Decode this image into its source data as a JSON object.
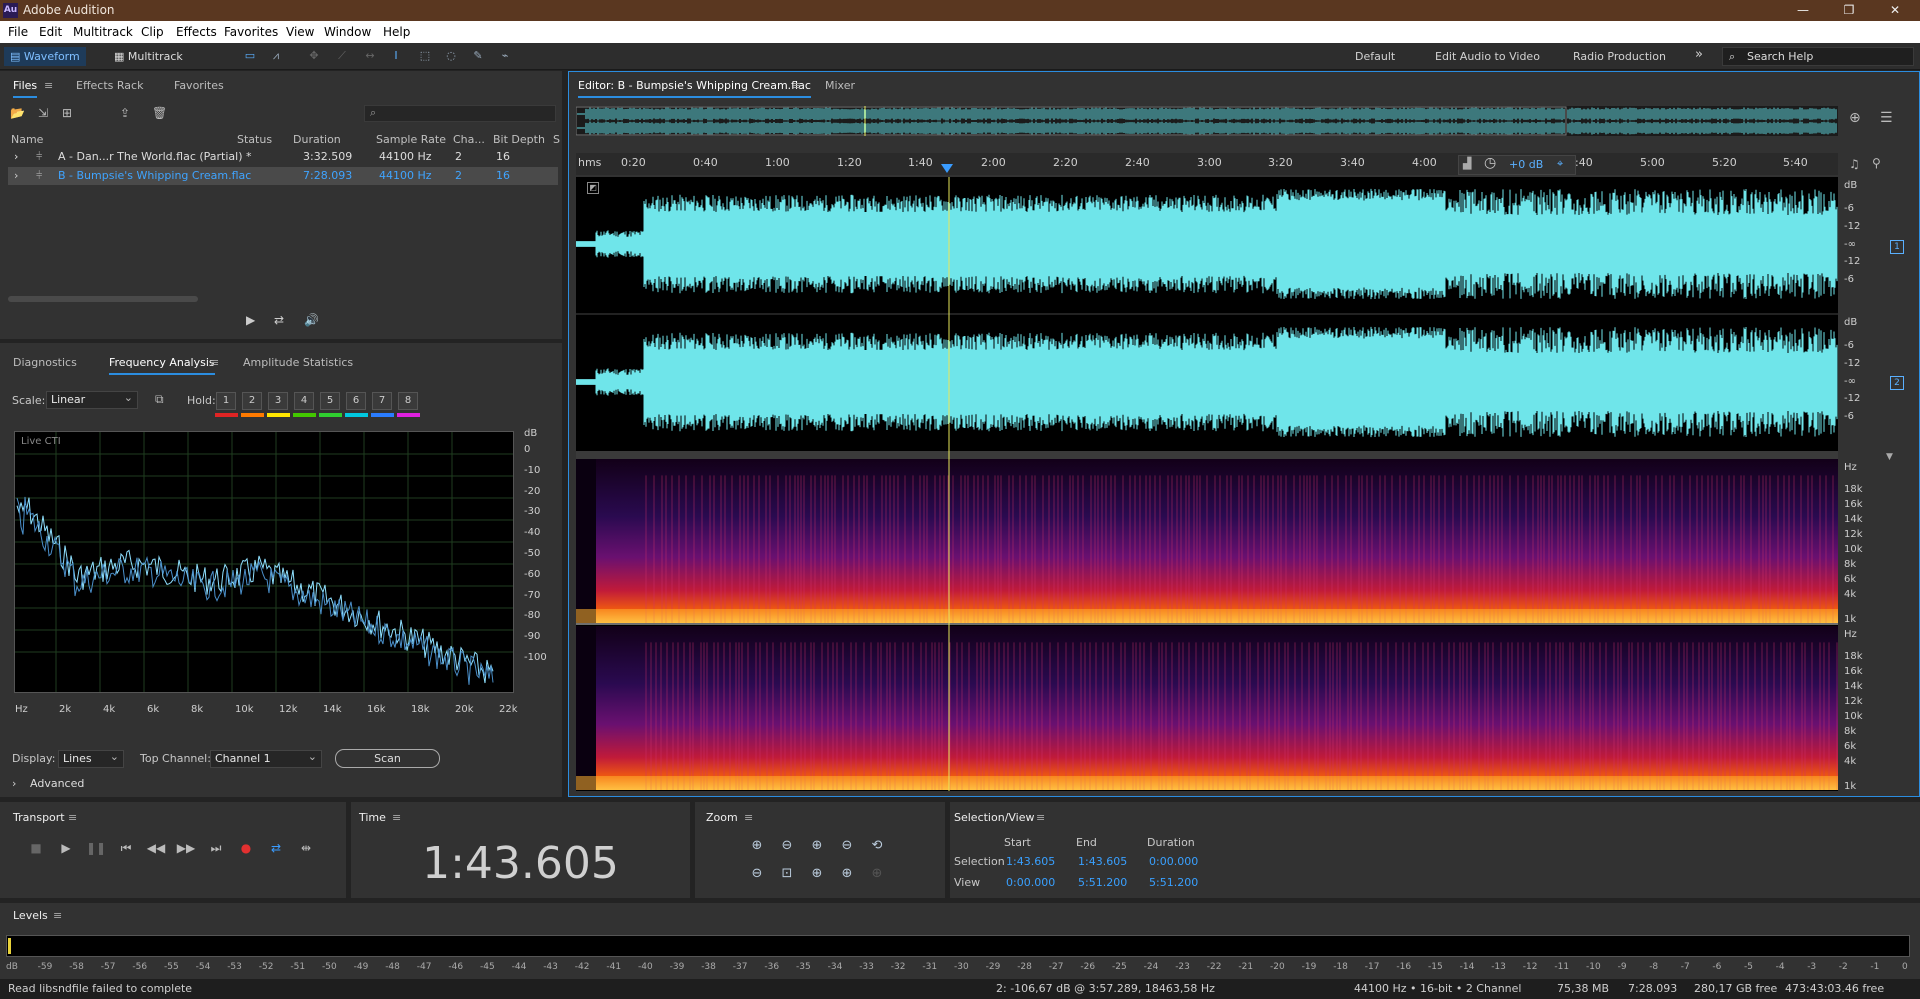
{
  "app": {
    "title": "Adobe Audition",
    "logo": "Au"
  },
  "menu": [
    "File",
    "Edit",
    "Multitrack",
    "Clip",
    "Effects",
    "Favorites",
    "View",
    "Window",
    "Help"
  ],
  "toolbar": {
    "waveform": "Waveform",
    "multitrack": "Multitrack",
    "workspaces": [
      "Default",
      "Edit Audio to Video",
      "Radio Production"
    ],
    "search_placeholder": "Search Help"
  },
  "files_panel": {
    "tabs": [
      "Files",
      "Effects Rack",
      "Favorites"
    ],
    "columns": [
      "Name",
      "Status",
      "Duration",
      "Sample Rate",
      "Cha...",
      "Bit Depth",
      "S"
    ],
    "rows": [
      {
        "name": "A - Dan...r The World.flac (Partial) *",
        "duration": "3:32.509",
        "rate": "44100 Hz",
        "channels": "2",
        "depth": "16"
      },
      {
        "name": "B - Bumpsie's Whipping Cream.flac",
        "duration": "7:28.093",
        "rate": "44100 Hz",
        "channels": "2",
        "depth": "16"
      }
    ]
  },
  "analysis_panel": {
    "tabs": [
      "Diagnostics",
      "Frequency Analysis",
      "Amplitude Statistics"
    ],
    "scale_label": "Scale:",
    "scale_value": "Linear",
    "hold_label": "Hold:",
    "hold_buttons": [
      "1",
      "2",
      "3",
      "4",
      "5",
      "6",
      "7",
      "8"
    ],
    "hold_colors": [
      "#e02424",
      "#ff7a00",
      "#ffe600",
      "#43c800",
      "#2fce2f",
      "#00c8e0",
      "#2a7cff",
      "#e020e0"
    ],
    "live_cti": "Live CTI",
    "db_unit": "dB",
    "db_ticks": [
      "0",
      "-10",
      "-20",
      "-30",
      "-40",
      "-50",
      "-60",
      "-70",
      "-80",
      "-90",
      "-100"
    ],
    "hz_ticks": [
      "Hz",
      "2k",
      "4k",
      "6k",
      "8k",
      "10k",
      "12k",
      "14k",
      "16k",
      "18k",
      "20k",
      "22k"
    ],
    "display_label": "Display:",
    "display_value": "Lines",
    "top_channel_label": "Top Channel:",
    "top_channel_value": "Channel 1",
    "scan": "Scan",
    "advanced": "Advanced"
  },
  "editor": {
    "tab": "Editor: B - Bumpsie's Whipping Cream.flac",
    "mixer": "Mixer",
    "time_unit": "hms",
    "time_ticks": [
      "0:20",
      "0:40",
      "1:00",
      "1:20",
      "1:40",
      "2:00",
      "2:20",
      "2:40",
      "3:00",
      "3:20",
      "3:40",
      "4:00",
      "4:40",
      "5:00",
      "5:20",
      "5:40"
    ],
    "gain": "+0 dB",
    "ch1_db": [
      "dB",
      "-6",
      "-12",
      "-∞",
      "-12",
      "-6"
    ],
    "ch2_db": [
      "dB",
      "-6",
      "-12",
      "-∞",
      "-12",
      "-6"
    ],
    "ch1_num": "1",
    "ch2_num": "2",
    "hz_ticks": [
      "Hz",
      "18k",
      "16k",
      "14k",
      "12k",
      "10k",
      "8k",
      "6k",
      "4k",
      "1k"
    ],
    "playhead_time": "1:43.605",
    "playhead_fraction": 0.2955
  },
  "transport": {
    "title": "Transport",
    "buttons": [
      "stop",
      "play",
      "pause",
      "to-start",
      "rewind",
      "fast-forward",
      "to-end",
      "record",
      "loop",
      "skip"
    ]
  },
  "time": {
    "title": "Time",
    "value": "1:43.605"
  },
  "zoom": {
    "title": "Zoom"
  },
  "selection": {
    "title": "Selection/View",
    "headers": [
      "Start",
      "End",
      "Duration"
    ],
    "selection_label": "Selection",
    "view_label": "View",
    "selection": [
      "1:43.605",
      "1:43.605",
      "0:00.000"
    ],
    "view": [
      "0:00.000",
      "5:51.200",
      "5:51.200"
    ]
  },
  "levels": {
    "title": "Levels",
    "ticks": [
      "dB",
      "-59",
      "-58",
      "-57",
      "-56",
      "-55",
      "-54",
      "-53",
      "-52",
      "-51",
      "-50",
      "-49",
      "-48",
      "-47",
      "-46",
      "-45",
      "-44",
      "-43",
      "-42",
      "-41",
      "-40",
      "-39",
      "-38",
      "-37",
      "-36",
      "-35",
      "-34",
      "-33",
      "-32",
      "-31",
      "-30",
      "-29",
      "-28",
      "-27",
      "-26",
      "-25",
      "-24",
      "-23",
      "-22",
      "-21",
      "-20",
      "-19",
      "-18",
      "-17",
      "-16",
      "-15",
      "-14",
      "-13",
      "-12",
      "-11",
      "-10",
      "-9",
      "-8",
      "-7",
      "-6",
      "-5",
      "-4",
      "-3",
      "-2",
      "-1",
      "0"
    ]
  },
  "status": {
    "message": "Read libsndfile failed to complete",
    "cursor": "2: -106,67 dB @ 3:57.289, 18463,58 Hz",
    "format": "44100 Hz • 16-bit • 2 Channel",
    "size": "75,38 MB",
    "duration": "7:28.093",
    "free": "280,17 GB free",
    "free_time": "473:43:03.46 free"
  }
}
